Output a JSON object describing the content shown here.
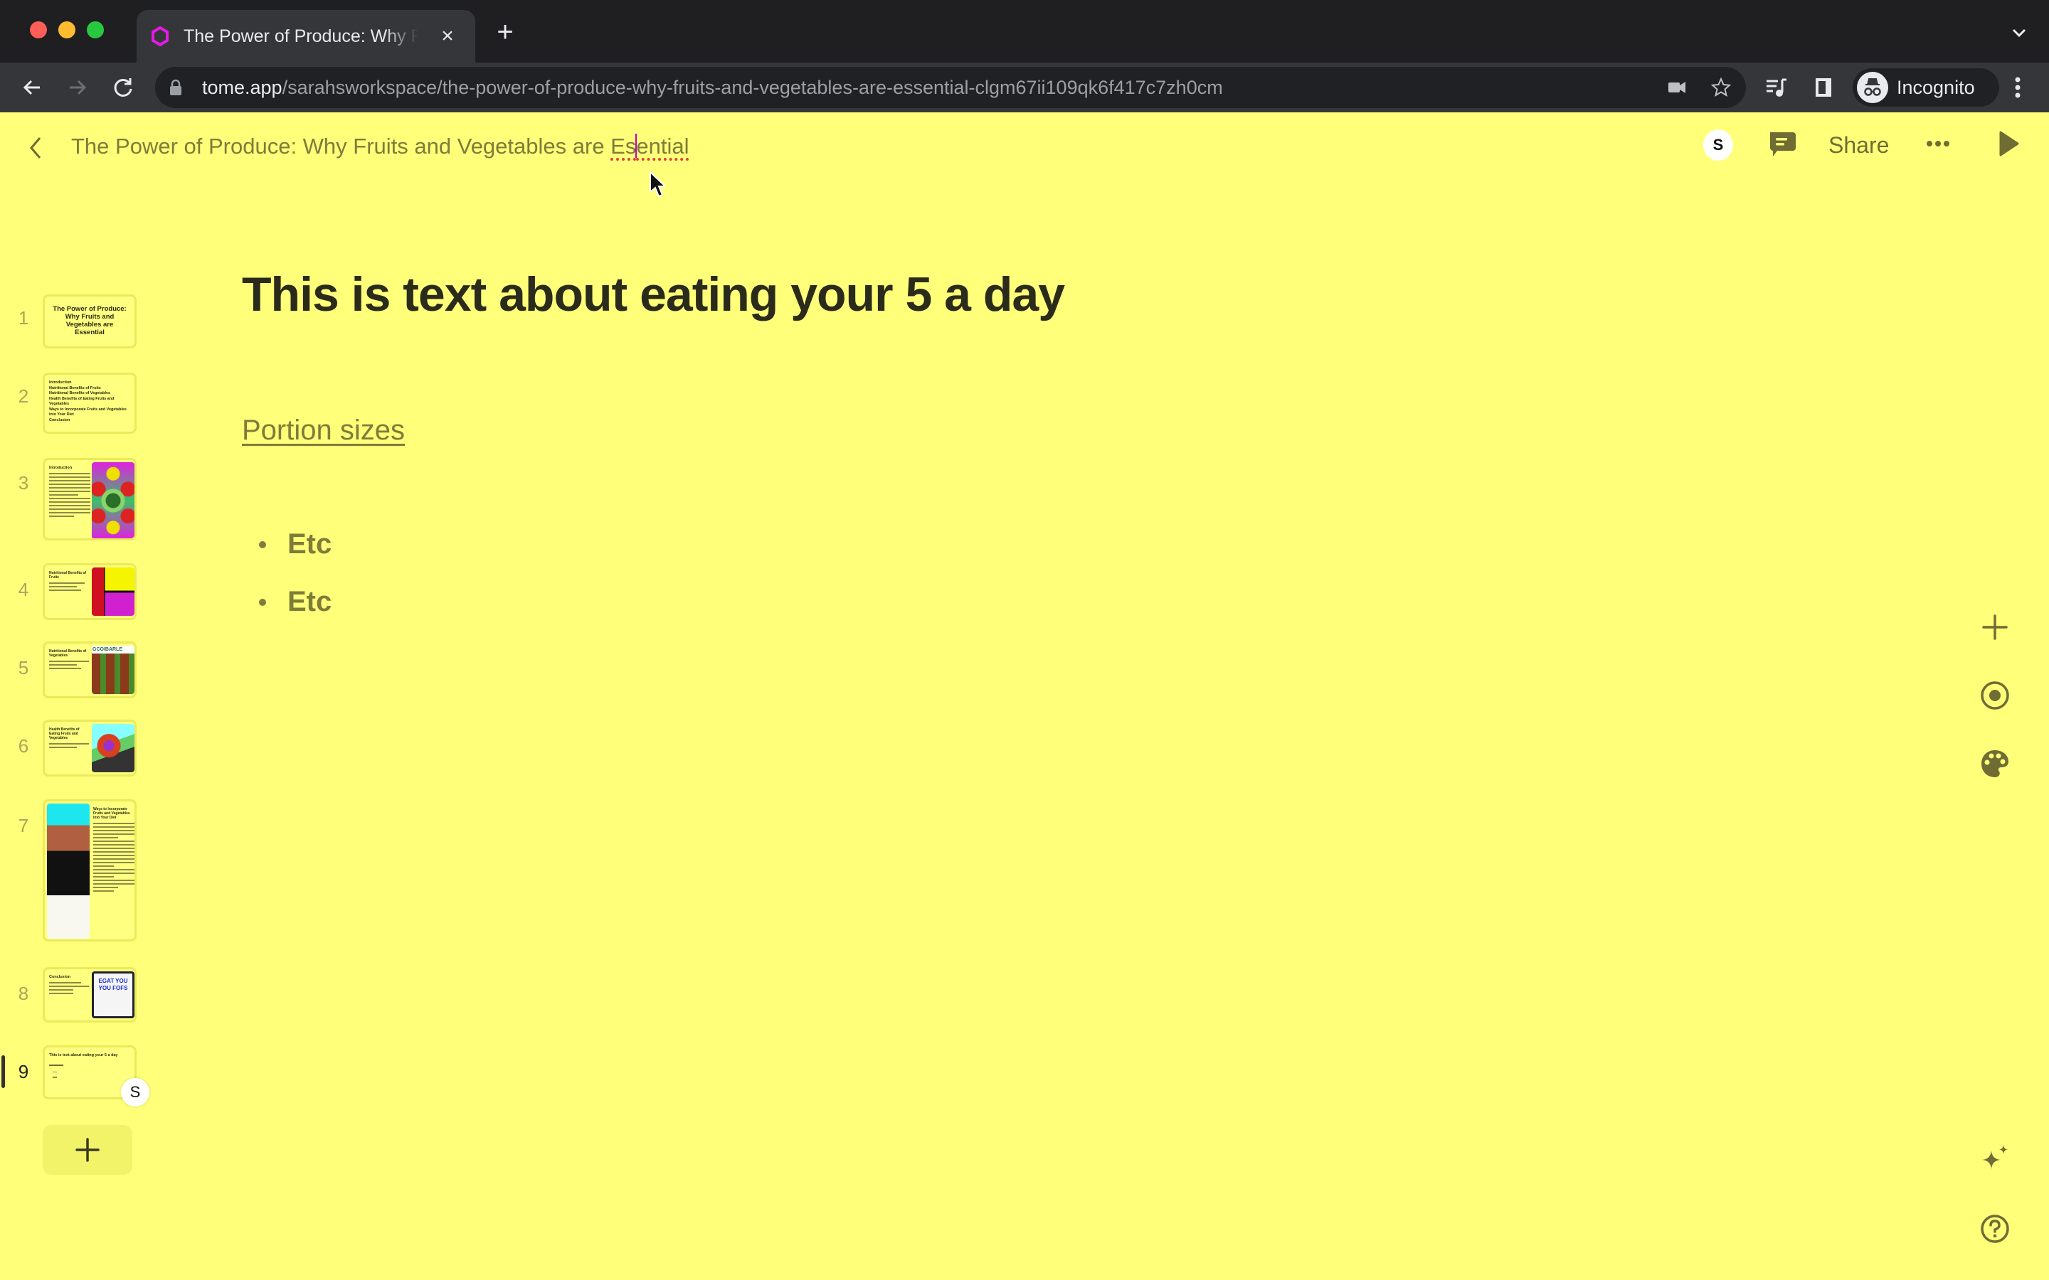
{
  "browser": {
    "tab": {
      "title": "The Power of Produce: Why Fruits and Vegetables are Essential",
      "favicon": "tome-logo-icon",
      "favicon_color": "#e31be3",
      "close_icon": "close-icon"
    },
    "new_tab_icon": "plus-icon",
    "tab_search_icon": "chevron-down-icon",
    "nav": {
      "back": "back-arrow-icon",
      "forward": "forward-arrow-icon",
      "reload": "reload-icon"
    },
    "address_bar": {
      "host": "tome.app",
      "path": "/sarahsworkspace/the-power-of-produce-why-fruits-and-vegetables-are-essential-clgm67ii109qk6f417c7zh0cm",
      "icons": [
        "lock-icon",
        "camera-blocked-icon",
        "star-icon"
      ]
    },
    "toolbar_icons": [
      "media-control-icon",
      "side-panel-icon"
    ],
    "profile": {
      "label": "Incognito",
      "icon": "incognito-icon"
    },
    "menu_icon": "kebab-menu-icon"
  },
  "header": {
    "back_icon": "chevron-left-icon",
    "title_main": "The Power of Produce: Why Fruits and Vegetables are ",
    "title_typo_start": "Es",
    "title_typo_end": "ential",
    "presence_initial": "S",
    "comment_icon": "comment-icon",
    "share_label": "Share",
    "more_icon": "more-horizontal-icon",
    "present_icon": "play-icon"
  },
  "sidebar": {
    "pages": [
      {
        "number": "1",
        "title": "The Power of Produce: Why Fruits and Vegetables are Essential"
      },
      {
        "number": "2",
        "items": [
          "Introduction",
          "Nutritional Benefits of Fruits",
          "Nutritional Benefits of Vegetables",
          "Health Benefits of Eating Fruits and Vegetables",
          "Ways to Incorporate Fruits and Vegetables into Your Diet",
          "Conclusion"
        ]
      },
      {
        "number": "3",
        "title": "Introduction"
      },
      {
        "number": "4",
        "title": "Nutritional Benefits of Fruits"
      },
      {
        "number": "5",
        "title": "Nutritional Benefits of Vegetables",
        "image_text": "GCOIBARLE"
      },
      {
        "number": "6",
        "title": "Health Benefits of Eating Fruits and Vegetables"
      },
      {
        "number": "7",
        "title": "Ways to Incorporate Fruits and Vegetables into Your Diet"
      },
      {
        "number": "8",
        "title": "Conclusion",
        "image_text": "EGAT YOU YOU FOFS"
      },
      {
        "number": "9",
        "title": "This is text about eating your 5 a day",
        "active": true
      }
    ],
    "presence_initial": "S",
    "add_page_icon": "plus-icon"
  },
  "slide": {
    "title": "This is text about eating your 5 a day",
    "link": "Portion sizes",
    "bullets": [
      "Etc",
      "Etc"
    ]
  },
  "right_rail": {
    "icons": [
      "add-tile-icon",
      "record-icon",
      "theme-palette-icon",
      "ai-sparkle-icon",
      "help-icon"
    ]
  },
  "colors": {
    "background": "#ffff7a",
    "text_muted": "#7e7c39",
    "text_strong": "#2b2b1c",
    "icon": "#6f6d33",
    "spellcheck": "#e0443a"
  }
}
